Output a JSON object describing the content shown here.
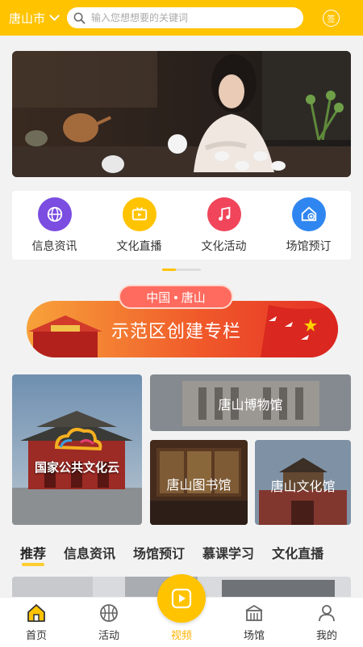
{
  "header": {
    "city": "唐山市",
    "search_placeholder": "输入您想想要的关键词",
    "sign_label": "签"
  },
  "nav": [
    {
      "label": "信息资讯",
      "icon": "globe-icon",
      "color": "#7b4de0"
    },
    {
      "label": "文化直播",
      "icon": "tv-icon",
      "color": "#ffc300"
    },
    {
      "label": "文化活动",
      "icon": "music-note-icon",
      "color": "#f0455b"
    },
    {
      "label": "场馆预订",
      "icon": "house-add-icon",
      "color": "#2f86f0"
    }
  ],
  "promo": {
    "pill": "中国 • 唐山",
    "title": "示范区创建专栏"
  },
  "tiles": {
    "main_caption": "国家公共文化云",
    "museum": "唐山博物馆",
    "library": "唐山图书馆",
    "culture_center": "唐山文化馆"
  },
  "tabs": [
    "推荐",
    "信息资讯",
    "场馆预订",
    "慕课学习",
    "文化直播"
  ],
  "bottom_nav": [
    "首页",
    "活动",
    "视频",
    "场馆",
    "我的"
  ],
  "colors": {
    "accent": "#ffc300",
    "active_label": "#ffb300"
  }
}
